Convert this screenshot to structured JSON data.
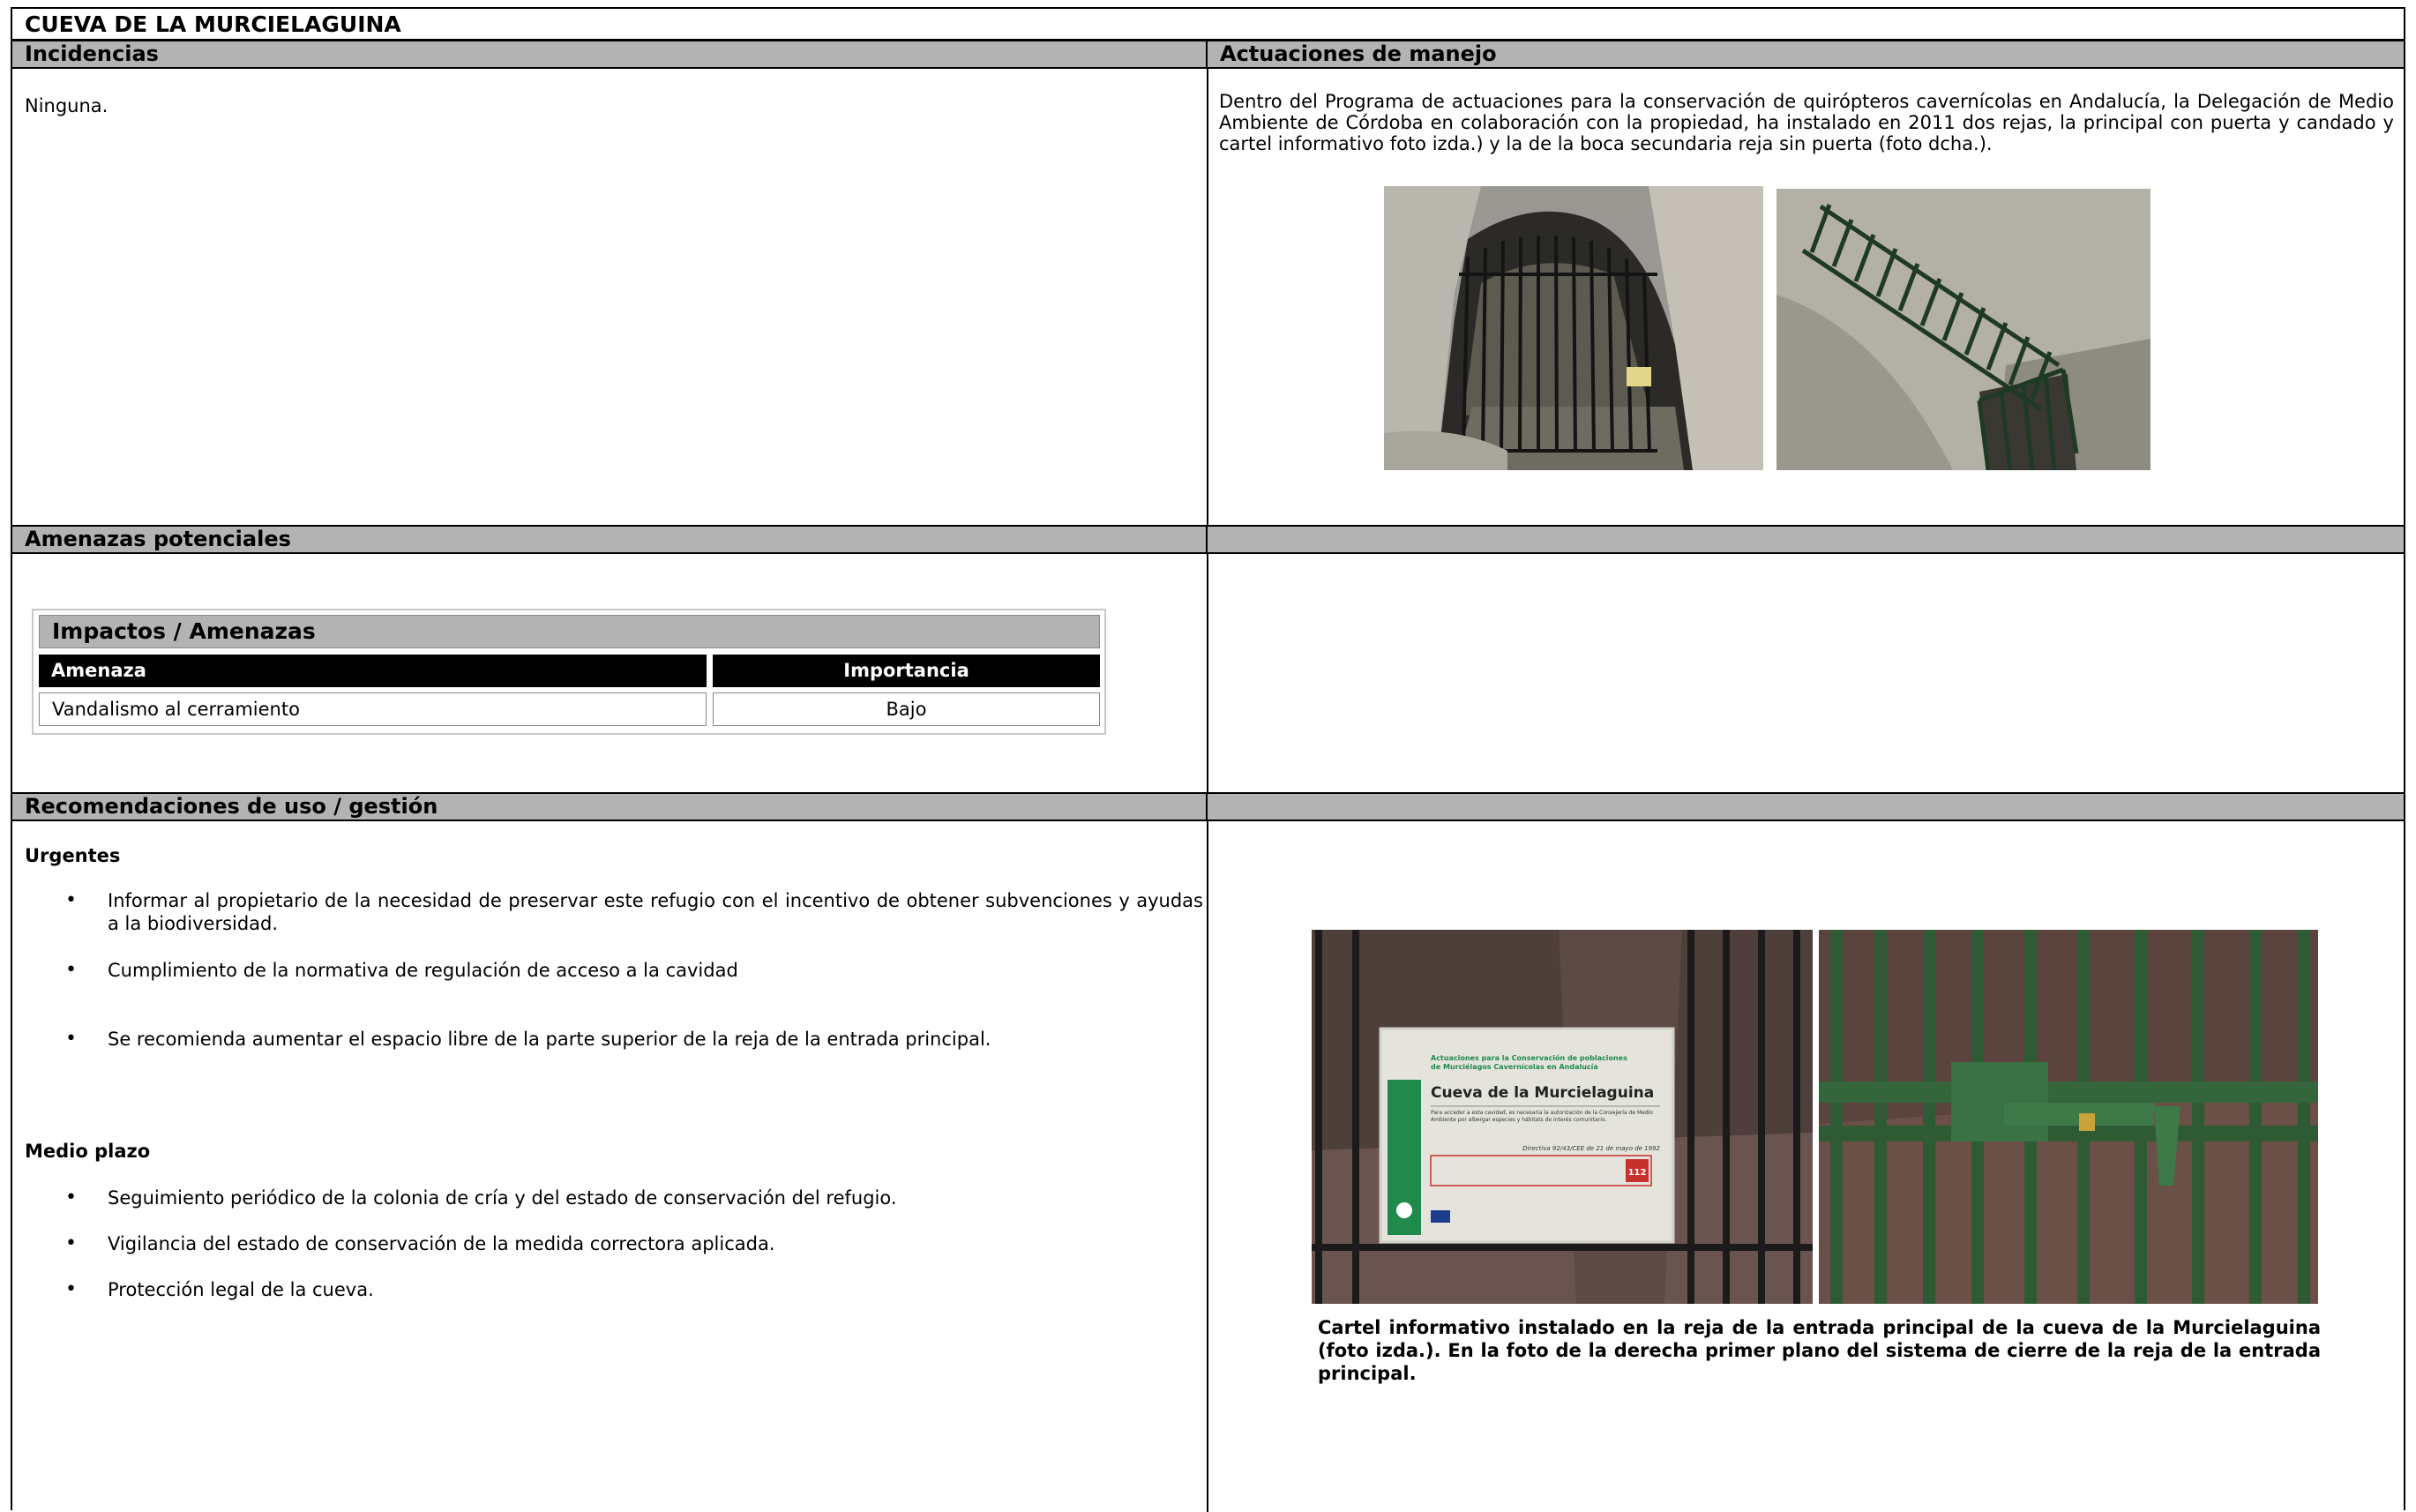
{
  "title": "CUEVA DE LA MURCIELAGUINA",
  "sections": {
    "incidencias": {
      "heading": "Incidencias",
      "text": "Ninguna."
    },
    "actuaciones": {
      "heading": "Actuaciones de manejo",
      "text": "Dentro del Programa de actuaciones para la conservación de quirópteros cavernícolas en Andalucía, la Delegación de Medio Ambiente de Córdoba en colaboración con la propiedad, ha instalado en 2011 dos rejas, la principal con puerta y candado y cartel informativo foto izda.) y  la de la boca secundaria reja sin puerta (foto dcha.)."
    },
    "amenazas": {
      "heading": "Amenazas potenciales",
      "table": {
        "title": "Impactos / Amenazas",
        "columns": [
          "Amenaza",
          "Importancia"
        ],
        "rows": [
          [
            "Vandalismo al cerramiento",
            "Bajo"
          ]
        ]
      }
    },
    "recomendaciones": {
      "heading": "Recomendaciones de uso / gestión",
      "urgentes_label": "Urgentes",
      "urgentes": [
        "Informar al propietario de la necesidad de preservar este refugio con el incentivo de obtener subvenciones y ayudas a la biodiversidad.",
        "Cumplimiento de la normativa de regulación de acceso a la cavidad",
        "Se recomienda aumentar el espacio libre de la parte superior de la reja de la entrada principal."
      ],
      "medio_label": "Medio plazo",
      "medio": [
        "Seguimiento periódico de la colonia de cría y del estado de conservación del refugio.",
        "Vigilancia del estado de conservación de la medida correctora aplicada.",
        "Protección legal de la cueva."
      ],
      "caption": "Cartel informativo instalado en la reja de la entrada principal de la cueva de la Murcielaguina (foto izda.). En la foto de la derecha primer plano del sistema de cierre de la reja de la entrada principal."
    }
  },
  "sign": {
    "header_line1": "Actuaciones para la Conservación de poblaciones",
    "header_line2": "de Murciélagos Cavernícolas en Andalucía",
    "name": "Cueva de la Murcielaguina",
    "body": "Para acceder a esta cavidad, es necesaria la autorización de la Consejería de Medio Ambiente por albergar especies y hábitats de interés comunitario.",
    "directive": "Directiva 92/43/CEE de 21 de mayo de 1992",
    "emergency": "112"
  },
  "colors": {
    "band": "#b3b3b3",
    "table_header": "#000000",
    "gate_green": "#2e5a34"
  },
  "icons": {
    "bullet": "bullet-dot-icon"
  }
}
